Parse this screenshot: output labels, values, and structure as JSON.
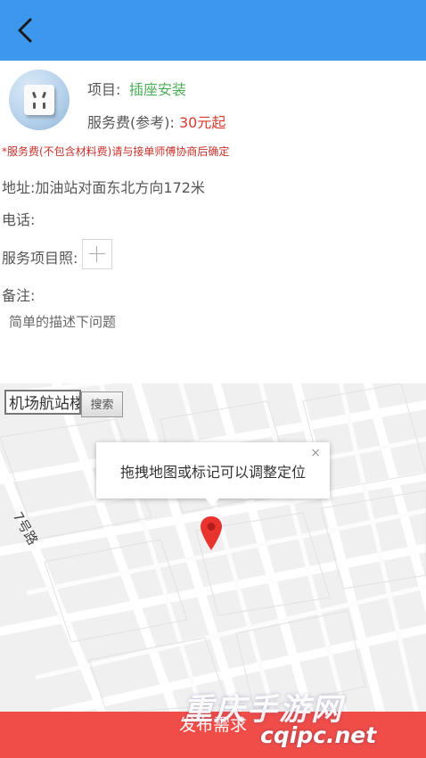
{
  "service": {
    "project_label": "项目:",
    "project_value": "插座安装",
    "fee_label": "服务费(参考):",
    "fee_value": "30元起",
    "note": "*服务费(不包含材料费)请与接单师傅协商后确定"
  },
  "form": {
    "address_label": "地址:加油站对面东北方向172米",
    "phone_label": "电话:",
    "photo_label": "服务项目照:",
    "remark_label": "备注:",
    "remark_placeholder": "简单的描述下问题"
  },
  "map": {
    "search_value": "机场航站楼",
    "search_button": "搜索",
    "popup_text": "拖拽地图或标记可以调整定位",
    "popup_close": "×",
    "road_label": "7号路"
  },
  "submit_label": "发布需求",
  "watermark": {
    "line1": "重庆手游网",
    "line2": "cqipc.net"
  },
  "colors": {
    "header": "#3d97ec",
    "submit": "#f04d49",
    "accent_green": "#4cae58",
    "accent_red": "#d83a2f",
    "pin": "#e8332f"
  },
  "icons": [
    "back-arrow-icon",
    "socket-icon",
    "add-photo-icon",
    "location-pin-icon",
    "close-icon"
  ]
}
